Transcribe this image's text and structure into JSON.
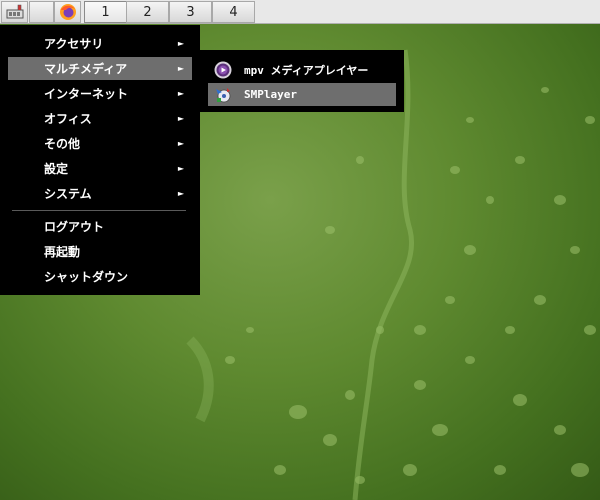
{
  "taskbar": {
    "workspaces": [
      "1",
      "2",
      "3",
      "4"
    ],
    "active_workspace": "1"
  },
  "menu": {
    "items": [
      {
        "label": "アクセサリ",
        "has_submenu": true
      },
      {
        "label": "マルチメディア",
        "has_submenu": true,
        "selected": true
      },
      {
        "label": "インターネット",
        "has_submenu": true
      },
      {
        "label": "オフィス",
        "has_submenu": true
      },
      {
        "label": "その他",
        "has_submenu": true
      },
      {
        "label": "設定",
        "has_submenu": true
      },
      {
        "label": "システム",
        "has_submenu": true
      }
    ],
    "session_items": [
      {
        "label": "ログアウト"
      },
      {
        "label": "再起動"
      },
      {
        "label": "シャットダウン"
      }
    ],
    "arrow": "►"
  },
  "submenu": {
    "items": [
      {
        "label": "mpv メディアプレイヤー",
        "icon": "mpv-icon"
      },
      {
        "label": "SMPlayer",
        "icon": "smplayer-icon",
        "selected": true
      }
    ]
  },
  "colors": {
    "menu_bg": "#000000",
    "menu_selected": "#6e6e6e",
    "desktop": "#5f8a30"
  }
}
